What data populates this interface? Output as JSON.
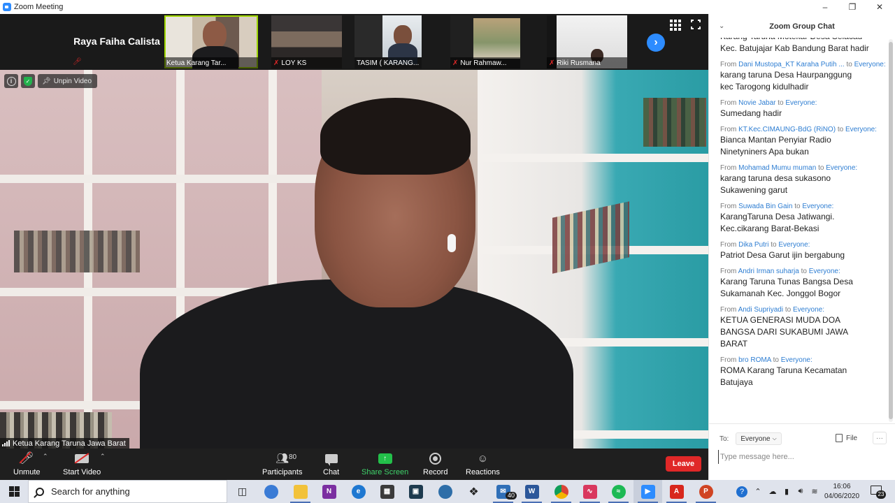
{
  "window": {
    "title": "Zoom Meeting"
  },
  "strip": {
    "name_only": "Raya Faiha Calista",
    "thumbnails": [
      {
        "name": "Ketua Karang Tar...",
        "muted": false,
        "active": true
      },
      {
        "name": "LOY KS",
        "muted": true,
        "active": false
      },
      {
        "name": "TASIM ( KARANG...",
        "muted": false,
        "active": false
      },
      {
        "name": "Nur Rahmaw...",
        "muted": true,
        "active": false
      },
      {
        "name": "Riki Rusmana",
        "muted": true,
        "active": false
      }
    ]
  },
  "main_video": {
    "unpin_label": "Unpin Video",
    "speaker_name": "Ketua Karang Taruna Jawa Barat"
  },
  "toolbar": {
    "unmute_label": "Unmute",
    "start_video_label": "Start Video",
    "participants_label": "Participants",
    "participants_count": "80",
    "chat_label": "Chat",
    "share_label": "Share Screen",
    "record_label": "Record",
    "reactions_label": "Reactions",
    "leave_label": "Leave"
  },
  "chat": {
    "title": "Zoom Group Chat",
    "top_partial": "Karang Taruna Motekar Desa Selacau\nKec. Batujajar Kab Bandung Barat hadir",
    "messages": [
      {
        "from_label": "From",
        "sender": "Dani Mustopa_KT Karaha Putih ...",
        "to_label": "to",
        "recipient": "Everyone:",
        "body": "karang taruna Desa Haurpanggung\nkec Tarogong kidulhadir"
      },
      {
        "from_label": "From",
        "sender": "Novie Jabar",
        "to_label": "to",
        "recipient": "Everyone:",
        "body": "Sumedang hadir"
      },
      {
        "from_label": "From",
        "sender": "KT.Kec.CIMAUNG-BdG (RiNO)",
        "to_label": "to",
        "recipient": "Everyone:",
        "body": "Bianca  Mantan Penyiar Radio\nNinetyniners Apa bukan"
      },
      {
        "from_label": "From",
        "sender": "Mohamad Mumu muman",
        "to_label": "to",
        "recipient": "Everyone:",
        "body": "karang taruna desa sukasono\nSukawening garut"
      },
      {
        "from_label": "From",
        "sender": "Suwada Bin Gain",
        "to_label": "to",
        "recipient": "Everyone:",
        "body": "KarangTaruna Desa Jatiwangi.\nKec.cikarang Barat-Bekasi"
      },
      {
        "from_label": "From",
        "sender": "Dika Putri",
        "to_label": "to",
        "recipient": "Everyone:",
        "body": "Patriot Desa Garut ijin bergabung"
      },
      {
        "from_label": "From",
        "sender": "Andri Irman suharja",
        "to_label": "to",
        "recipient": "Everyone:",
        "body": "Karang Taruna Tunas Bangsa Desa\nSukamanah Kec. Jonggol Bogor"
      },
      {
        "from_label": "From",
        "sender": "Andi Supriyadi",
        "to_label": "to",
        "recipient": "Everyone:",
        "body": "KETUA GENERASI MUDA DOA\nBANGSA DARI SUKABUMI JAWA\nBARAT"
      },
      {
        "from_label": "From",
        "sender": "bro ROMA",
        "to_label": "to",
        "recipient": "Everyone:",
        "body": "ROMA Karang Taruna Kecamatan\nBatujaya"
      }
    ],
    "to_label": "To:",
    "to_value": "Everyone",
    "file_label": "File",
    "input_placeholder": "Type message here..."
  },
  "taskbar": {
    "search_text": "Search for anything",
    "mail_badge": "40",
    "time": "16:06",
    "date": "04/06/2020",
    "notification_count": "23"
  }
}
